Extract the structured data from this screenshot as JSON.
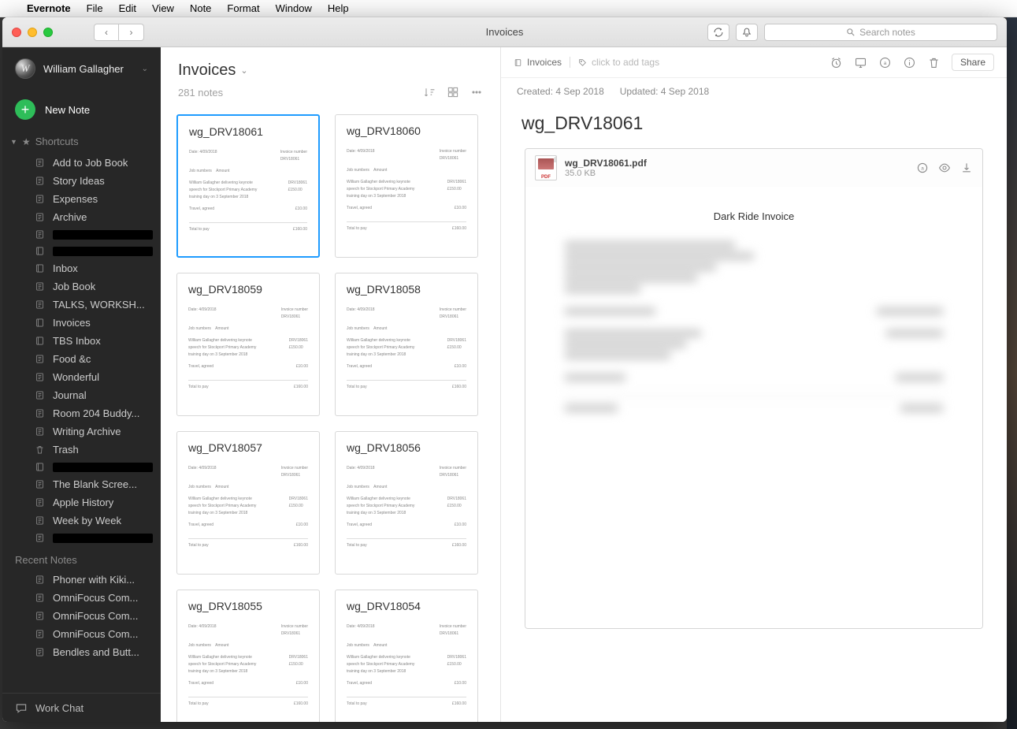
{
  "menubar": {
    "app": "Evernote",
    "items": [
      "File",
      "Edit",
      "View",
      "Note",
      "Format",
      "Window",
      "Help"
    ]
  },
  "window": {
    "title": "Invoices",
    "search_placeholder": "Search notes"
  },
  "sidebar": {
    "user_name": "William Gallagher",
    "new_note_label": "New Note",
    "shortcuts_header": "Shortcuts",
    "shortcuts": [
      {
        "icon": "note",
        "label": "Add to Job Book"
      },
      {
        "icon": "note",
        "label": "Story Ideas"
      },
      {
        "icon": "note",
        "label": "Expenses"
      },
      {
        "icon": "note",
        "label": "Archive"
      },
      {
        "icon": "note",
        "label": "",
        "redacted": true
      },
      {
        "icon": "notebook",
        "label": "",
        "redacted": true
      },
      {
        "icon": "notebook",
        "label": "Inbox"
      },
      {
        "icon": "note",
        "label": "Job Book"
      },
      {
        "icon": "note",
        "label": "TALKS, WORKSH..."
      },
      {
        "icon": "notebook",
        "label": "Invoices"
      },
      {
        "icon": "notebook",
        "label": "TBS Inbox"
      },
      {
        "icon": "note",
        "label": "Food &c"
      },
      {
        "icon": "note",
        "label": "Wonderful"
      },
      {
        "icon": "note",
        "label": "Journal"
      },
      {
        "icon": "note",
        "label": "Room 204 Buddy..."
      },
      {
        "icon": "note",
        "label": "Writing Archive"
      },
      {
        "icon": "trash",
        "label": "Trash"
      },
      {
        "icon": "notebook",
        "label": "",
        "redacted": true
      },
      {
        "icon": "note",
        "label": "The Blank Scree..."
      },
      {
        "icon": "note",
        "label": "Apple History"
      },
      {
        "icon": "note",
        "label": "Week by Week"
      },
      {
        "icon": "note",
        "label": "",
        "redacted": true
      }
    ],
    "recent_header": "Recent Notes",
    "recent": [
      {
        "label": "Phoner with Kiki..."
      },
      {
        "label": "OmniFocus Com..."
      },
      {
        "label": "OmniFocus Com..."
      },
      {
        "label": "OmniFocus Com..."
      },
      {
        "label": "Bendles and Butt..."
      }
    ],
    "workchat_label": "Work Chat"
  },
  "notelist": {
    "title": "Invoices",
    "count": "281 notes",
    "cards": [
      {
        "title": "wg_DRV18061",
        "selected": true
      },
      {
        "title": "wg_DRV18060"
      },
      {
        "title": "wg_DRV18059"
      },
      {
        "title": "wg_DRV18058"
      },
      {
        "title": "wg_DRV18057"
      },
      {
        "title": "wg_DRV18056"
      },
      {
        "title": "wg_DRV18055"
      },
      {
        "title": "wg_DRV18054"
      }
    ]
  },
  "detail": {
    "breadcrumb_notebook": "Invoices",
    "add_tags_placeholder": "click to add tags",
    "share_label": "Share",
    "created_label": "Created: 4 Sep 2018",
    "updated_label": "Updated: 4 Sep 2018",
    "note_title": "wg_DRV18061",
    "pdf": {
      "filename": "wg_DRV18061.pdf",
      "filesize": "35.0 KB",
      "invoice_title": "Dark Ride Invoice"
    }
  }
}
